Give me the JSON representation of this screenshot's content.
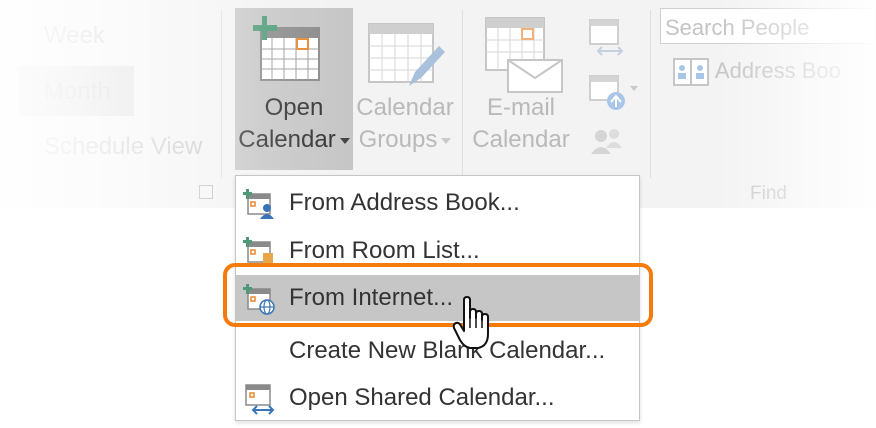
{
  "left_group": {
    "items": [
      {
        "label": "Week"
      },
      {
        "label": "Month",
        "selected": true
      },
      {
        "label": "Schedule View"
      }
    ]
  },
  "open_calendar": {
    "line1": "Open",
    "line2": "Calendar",
    "icon": "calendar-add-icon"
  },
  "calendar_groups": {
    "line1": "Calendar",
    "line2": "Groups",
    "icon": "calendar-edit-icon"
  },
  "email_calendar": {
    "line1": "E-mail",
    "line2": "Calendar",
    "icon": "calendar-email-icon"
  },
  "small_buttons": [
    {
      "icon": "share-calendar-icon"
    },
    {
      "icon": "publish-calendar-icon"
    },
    {
      "icon": "people-share-icon"
    }
  ],
  "find_group": {
    "search_placeholder": "Search People",
    "address_book_label": "Address Boo",
    "group_label": "Find"
  },
  "menu": {
    "items": [
      {
        "label": "From Address Book...",
        "icon": "calendar-person-icon"
      },
      {
        "label": "From Room List...",
        "icon": "calendar-room-icon"
      },
      {
        "label": "From Internet...",
        "icon": "calendar-globe-icon",
        "highlighted": true
      },
      {
        "label": "Create New Blank Calendar...",
        "icon": ""
      },
      {
        "label": "Open Shared Calendar...",
        "icon": "calendar-shared-icon"
      }
    ]
  },
  "colors": {
    "accent_ring": "#f47b0c",
    "selected_bg": "#c6c6c6",
    "plus_green": "#4e9a78"
  }
}
